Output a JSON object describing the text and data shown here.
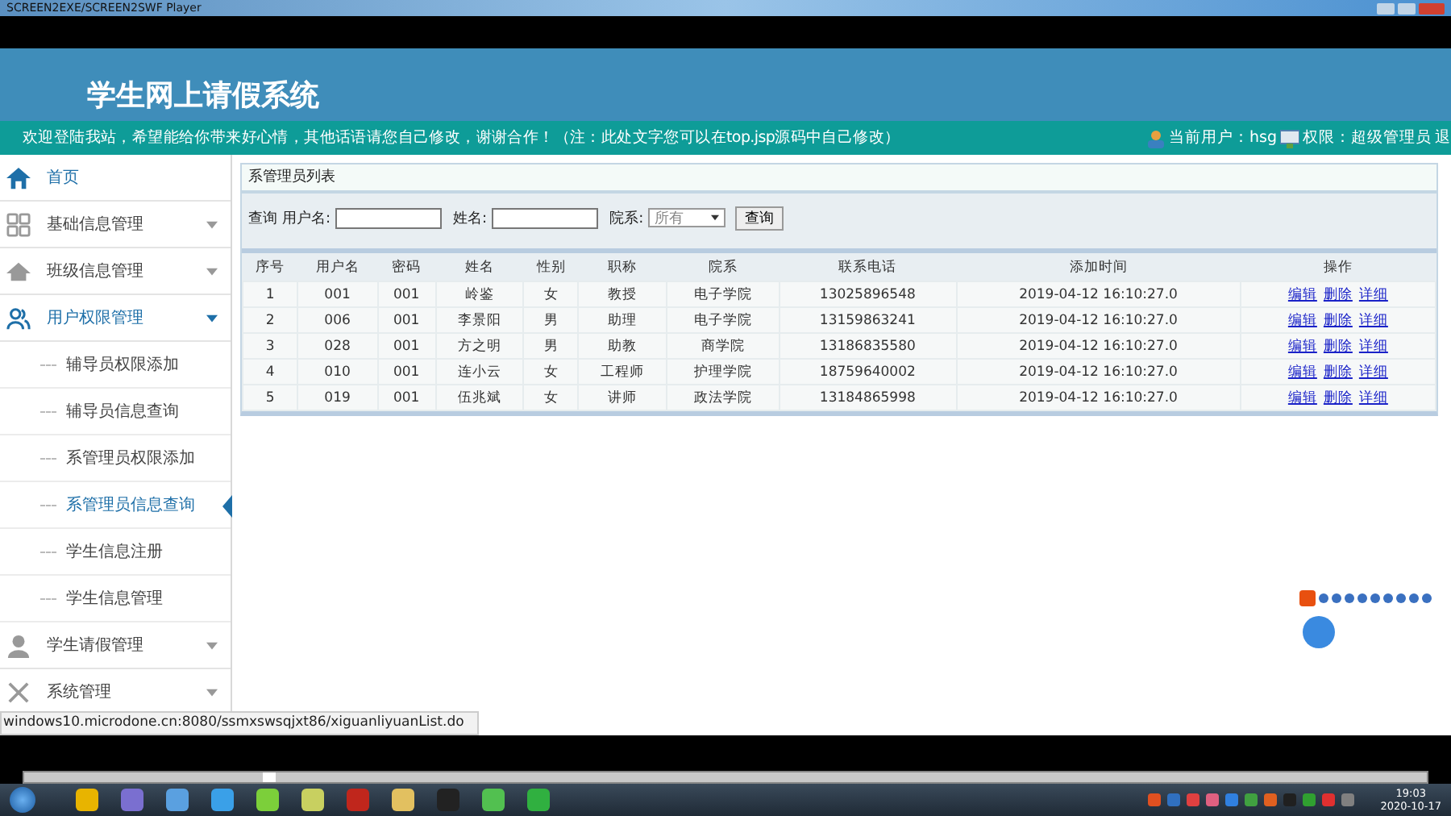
{
  "player": {
    "title": "SCREEN2EXE/SCREEN2SWF Player",
    "clock_time": "19:03",
    "clock_date": "2020-10-17"
  },
  "header": {
    "title": "学生网上请假系统",
    "welcome": "欢迎登陆我站，希望能给你带来好心情，其他话语请您自己修改，谢谢合作！（注：此处文字您可以在top.jsp源码中自己修改）",
    "current_user": "当前用户：hsg",
    "role": "权限：超级管理员",
    "logout": "退"
  },
  "sidebar": {
    "items": [
      {
        "label": "首页"
      },
      {
        "label": "基础信息管理",
        "expanded": false
      },
      {
        "label": "班级信息管理",
        "expanded": false
      },
      {
        "label": "用户权限管理",
        "expanded": true,
        "children": [
          {
            "label": "辅导员权限添加",
            "selected": false
          },
          {
            "label": "辅导员信息查询",
            "selected": false
          },
          {
            "label": "系管理员权限添加",
            "selected": false
          },
          {
            "label": "系管理员信息查询",
            "selected": true
          },
          {
            "label": "学生信息注册",
            "selected": false
          },
          {
            "label": "学生信息管理",
            "selected": false
          }
        ]
      },
      {
        "label": "学生请假管理",
        "expanded": false
      },
      {
        "label": "系统管理",
        "expanded": false
      }
    ]
  },
  "panel": {
    "title": "系管理员列表",
    "search": {
      "prefix": "查询",
      "fields": [
        {
          "label": "用户名:"
        },
        {
          "label": "姓名:"
        }
      ],
      "dept": {
        "label": "院系:",
        "value": "所有"
      },
      "button": "查询"
    },
    "table": {
      "columns": [
        "序号",
        "用户名",
        "密码",
        "姓名",
        "性别",
        "职称",
        "院系",
        "联系电话",
        "添加时间",
        "操作"
      ],
      "rows": [
        {
          "cells": [
            "1",
            "001",
            "001",
            "岭鉴",
            "女",
            "教授",
            "电子学院",
            "13025896548",
            "2019-04-12 16:10:27.0"
          ],
          "actions": [
            "编辑",
            "删除",
            "详细"
          ]
        },
        {
          "cells": [
            "2",
            "006",
            "001",
            "李景阳",
            "男",
            "助理",
            "电子学院",
            "13159863241",
            "2019-04-12 16:10:27.0"
          ],
          "actions": [
            "编辑",
            "删除",
            "详细"
          ]
        },
        {
          "cells": [
            "3",
            "028",
            "001",
            "方之明",
            "男",
            "助教",
            "商学院",
            "13186835580",
            "2019-04-12 16:10:27.0"
          ],
          "actions": [
            "编辑",
            "删除",
            "详细"
          ]
        },
        {
          "cells": [
            "4",
            "010",
            "001",
            "连小云",
            "女",
            "工程师",
            "护理学院",
            "18759640002",
            "2019-04-12 16:10:27.0"
          ],
          "actions": [
            "编辑",
            "删除",
            "详细"
          ]
        },
        {
          "cells": [
            "5",
            "019",
            "001",
            "伍兆斌",
            "女",
            "讲师",
            "政法学院",
            "13184865998",
            "2019-04-12 16:10:27.0"
          ],
          "actions": [
            "编辑",
            "删除",
            "详细"
          ]
        }
      ]
    }
  },
  "playback": {
    "level": 0.17
  },
  "status_url": "windows10.microdone.cn:8080/ssmxswsqjxt86/xiguanliyuanList.do"
}
